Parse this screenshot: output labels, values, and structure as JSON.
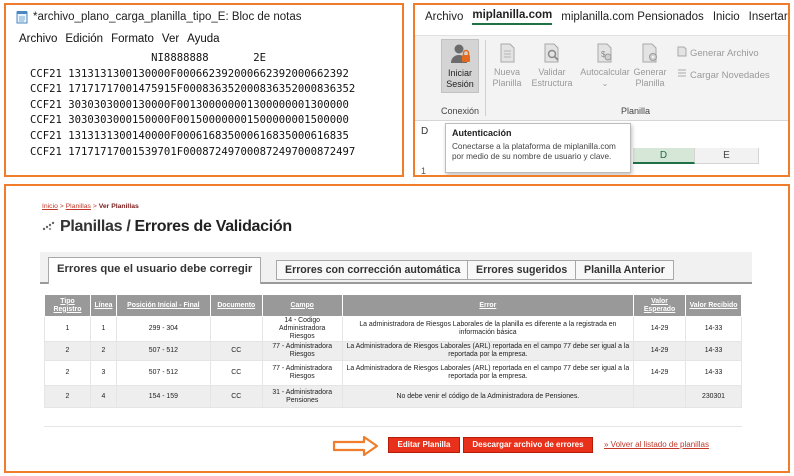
{
  "notepad": {
    "title": "*archivo_plano_carga_planilla_tipo_E: Bloc de notas",
    "menu": [
      "Archivo",
      "Edición",
      "Formato",
      "Ver",
      "Ayuda"
    ],
    "lines": [
      "                   NI8888888       2E",
      "CCF21 1313131300130000F000662392000662392000662392",
      "CCF21 17171717001475915F000836352000836352000836352",
      "CCF21 3030303000130000F001300000001300000001300000",
      "CCF21 3030303000150000F001500000001500000001500000",
      "CCF21 1313131300140000F000616835000616835000616835",
      "CCF21 17171717001539701F000872497000872497000872497"
    ]
  },
  "excel": {
    "tabs": [
      "Archivo",
      "miplanilla.com",
      "miplanilla.com Pensionados",
      "Inicio",
      "Insertar"
    ],
    "active_tab": 1,
    "buttons": {
      "iniciar": "Iniciar Sesión",
      "nueva": "Nueva Planilla",
      "validar": "Validar Estructura",
      "autocalcular": "Autocalcular",
      "generar": "Generar Planilla",
      "generar_archivo": "Generar Archivo",
      "cargar_novedades": "Cargar Novedades"
    },
    "groups": {
      "conexion": "Conexión",
      "planilla": "Planilla"
    },
    "columns": [
      "D",
      "E"
    ],
    "cell_fragment": "D",
    "row_fragment": "1",
    "tooltip": {
      "title": "Autenticación",
      "body": "Conectarse a la plataforma de miplanilla.com por medio de su nombre de usuario y clave."
    },
    "accent": "#1e7145"
  },
  "web": {
    "breadcrumb": {
      "inicio": "Inicio",
      "sep": ">",
      "planillas": "Planillas",
      "current": "Ver Planillas"
    },
    "title_part1": "Planillas /",
    "title_part2": "Errores de Validación",
    "tabs": [
      "Errores que el usuario debe corregir",
      "Errores con corrección automática",
      "Errores sugeridos",
      "Planilla Anterior"
    ],
    "table": {
      "headers": [
        "Tipo Registro",
        "Línea",
        "Posición Inicial - Final",
        "Documento",
        "Campo",
        "Error",
        "Valor Esperado",
        "Valor Recibido"
      ],
      "rows": [
        [
          "1",
          "1",
          "299 - 304",
          "",
          "14 - Codigo Administradora Riesgos",
          "La administradora de Riesgos Laborales de la planilla es diferente a la registrada en información básica",
          "14-29",
          "14-33"
        ],
        [
          "2",
          "2",
          "507 - 512",
          "CC",
          "77 - Administradora Riesgos",
          "La Administradora de Riesgos Laborales (ARL) reportada en el campo 77 debe ser igual a la reportada por la empresa.",
          "14-29",
          "14-33"
        ],
        [
          "2",
          "3",
          "507 - 512",
          "CC",
          "77 - Administradora Riesgos",
          "La Administradora de Riesgos Laborales (ARL) reportada en el campo 77 debe ser igual a la reportada por la empresa.",
          "14-29",
          "14-33"
        ],
        [
          "2",
          "4",
          "154 - 159",
          "CC",
          "31 - Administradora Pensiones",
          "No debe venir el código de la Administradora de Pensiones.",
          "",
          "230301"
        ]
      ]
    },
    "buttons": {
      "editar": "Editar Planilla",
      "descargar": "Descargar archivo de errores",
      "volver": "» Volver al listado de planillas"
    },
    "colors": {
      "border": "#f07d2b",
      "button": "#e8301a",
      "header": "#999999"
    }
  }
}
